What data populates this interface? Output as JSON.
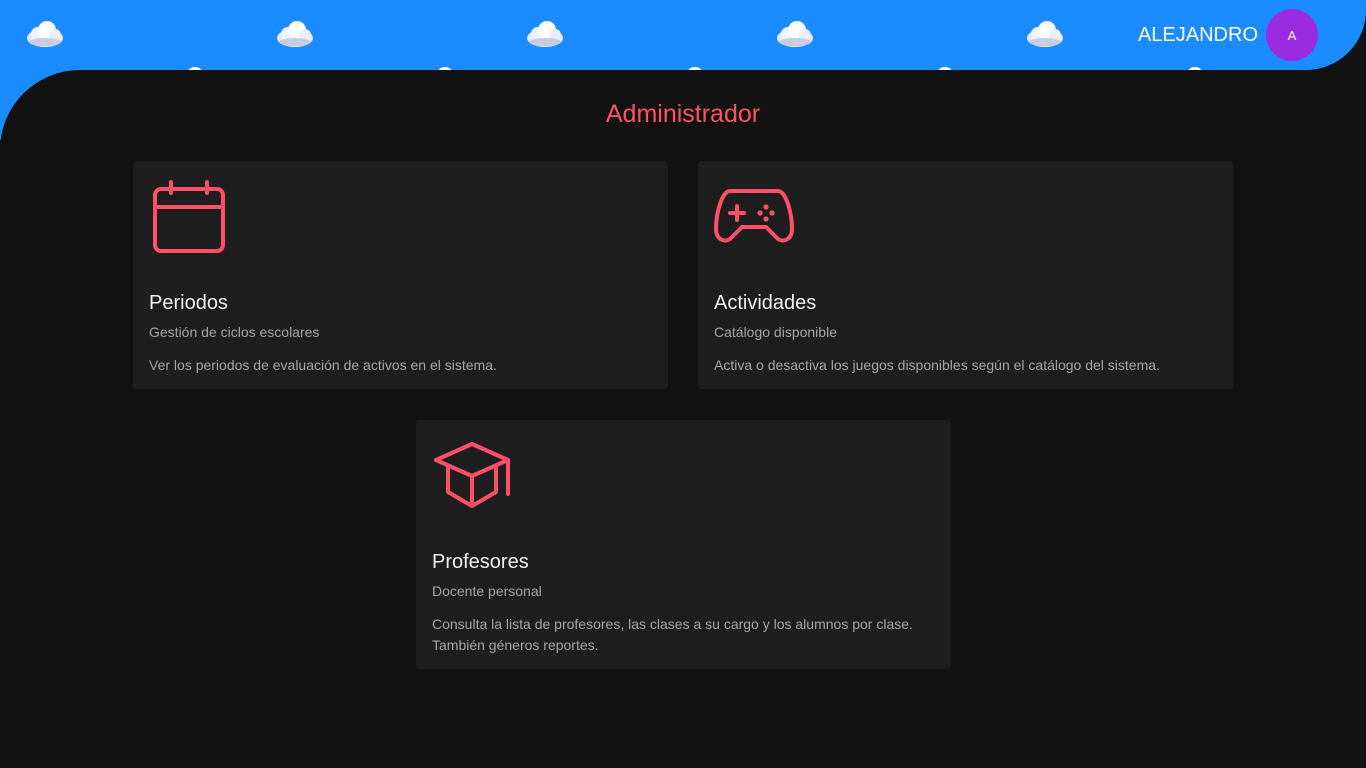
{
  "header": {
    "user_name": "ALEJANDRO",
    "avatar_initial": "A",
    "background_color": "#1a8cff",
    "avatar_color": "#9b2be0"
  },
  "main": {
    "title": "Administrador",
    "accent_color": "#ff5068",
    "cards": [
      {
        "icon": "calendar-icon",
        "title": "Periodos",
        "subtitle": "Gestión de ciclos escolares",
        "description": "Ver los periodos de evaluación de activos en el sistema."
      },
      {
        "icon": "gamepad-icon",
        "title": "Actividades",
        "subtitle": "Catálogo disponible",
        "description": "Activa o desactiva los juegos disponibles según el catálogo del sistema."
      },
      {
        "icon": "graduation-cap-icon",
        "title": "Profesores",
        "subtitle": "Docente personal",
        "description": "Consulta la lista de profesores, las clases a su cargo y los alumnos por clase. También géneros reportes."
      }
    ]
  }
}
